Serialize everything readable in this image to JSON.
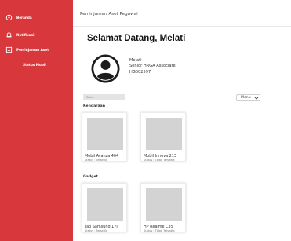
{
  "sidebar": {
    "items": [
      {
        "label": "Beranda",
        "icon": "home-icon"
      },
      {
        "label": "Notifikasi",
        "icon": "bell-icon"
      },
      {
        "label": "Peminjaman Aset",
        "icon": "asset-icon"
      }
    ],
    "status_label": "Status Mobil"
  },
  "header": {
    "title": "Peminjaman Aset Pegawai"
  },
  "greeting": "Selamat Datang, Melati",
  "profile": {
    "name": "Melati",
    "position": "Senior HRGA Associate",
    "employee_id": "HG002597"
  },
  "search": {
    "placeholder": "Cari..."
  },
  "menu_select": {
    "value": "Menu"
  },
  "sections": [
    {
      "title": "Kendaraan",
      "items": [
        {
          "name": "Mobil Avanza 404",
          "status": "Status : Tersedia"
        },
        {
          "name": "Mobil Innova 213",
          "status": "Status : Tidak Tersedia"
        }
      ]
    },
    {
      "title": "Gadget",
      "items": [
        {
          "name": "Tab Samsung 17J",
          "status": "Status : Tersedia"
        },
        {
          "name": "HP Realme C35",
          "status": "Status : Tidak Tersedia"
        }
      ]
    }
  ],
  "colors": {
    "sidebar": "#d8383c",
    "thumb": "#d3d3d3"
  }
}
